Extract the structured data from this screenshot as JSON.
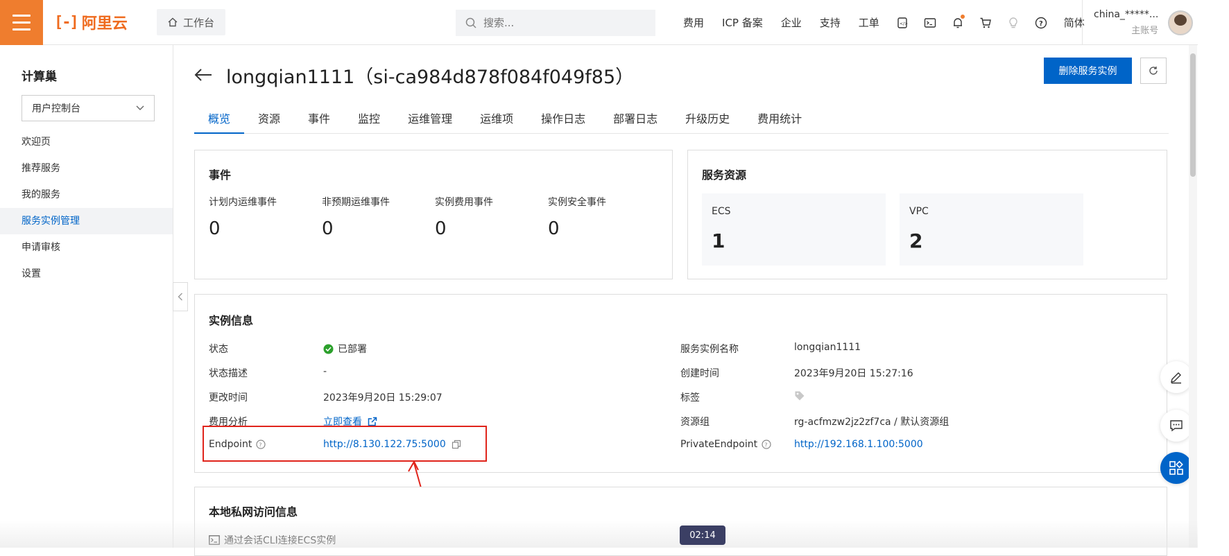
{
  "topbar": {
    "logo_text": "阿里云",
    "workbench_label": "工作台",
    "search_placeholder": "搜索...",
    "nav": [
      "费用",
      "ICP 备案",
      "企业",
      "支持",
      "工单"
    ],
    "lang": "简体",
    "account_name": "china_*****...",
    "account_type": "主账号",
    "accent_color": "#ef7d2e"
  },
  "sidebar": {
    "title": "计算巢",
    "console_select": "用户控制台",
    "items": [
      "欢迎页",
      "推荐服务",
      "我的服务",
      "服务实例管理",
      "申请审核",
      "设置"
    ],
    "active_index": 3
  },
  "page": {
    "title": "longqian1111（si-ca984d878f084f049f85）",
    "delete_button": "删除服务实例",
    "tabs": [
      "概览",
      "资源",
      "事件",
      "监控",
      "运维管理",
      "运维项",
      "操作日志",
      "部署日志",
      "升级历史",
      "费用统计"
    ],
    "active_tab": 0
  },
  "events": {
    "title": "事件",
    "items": [
      {
        "label": "计划内运维事件",
        "value": "0"
      },
      {
        "label": "非预期运维事件",
        "value": "0"
      },
      {
        "label": "实例费用事件",
        "value": "0"
      },
      {
        "label": "实例安全事件",
        "value": "0"
      }
    ]
  },
  "resources": {
    "title": "服务资源",
    "items": [
      {
        "label": "ECS",
        "value": "1"
      },
      {
        "label": "VPC",
        "value": "2"
      }
    ]
  },
  "instance_info": {
    "title": "实例信息",
    "status_label": "状态",
    "status_value": "已部署",
    "status_desc_label": "状态描述",
    "status_desc_value": "-",
    "modified_label": "更改时间",
    "modified_value": "2023年9月20日 15:29:07",
    "cost_label": "费用分析",
    "cost_link": "立即查看",
    "endpoint_label": "Endpoint",
    "endpoint_value": "http://8.130.122.75:5000",
    "name_label": "服务实例名称",
    "name_value": "longqian1111",
    "created_label": "创建时间",
    "created_value": "2023年9月20日 15:27:16",
    "tag_label": "标签",
    "rg_label": "资源组",
    "rg_value": "rg-acfmzw2jz2zf7ca / 默认资源组",
    "private_endpoint_label": "PrivateEndpoint",
    "private_endpoint_value": "http://192.168.1.100:5000",
    "status_color": "#2ca02c",
    "highlight_color": "#e0241b"
  },
  "local_network": {
    "title": "本地私网访问信息",
    "cli_label": "通过会话CLI连接ECS实例"
  },
  "recording_timer": "02:14"
}
